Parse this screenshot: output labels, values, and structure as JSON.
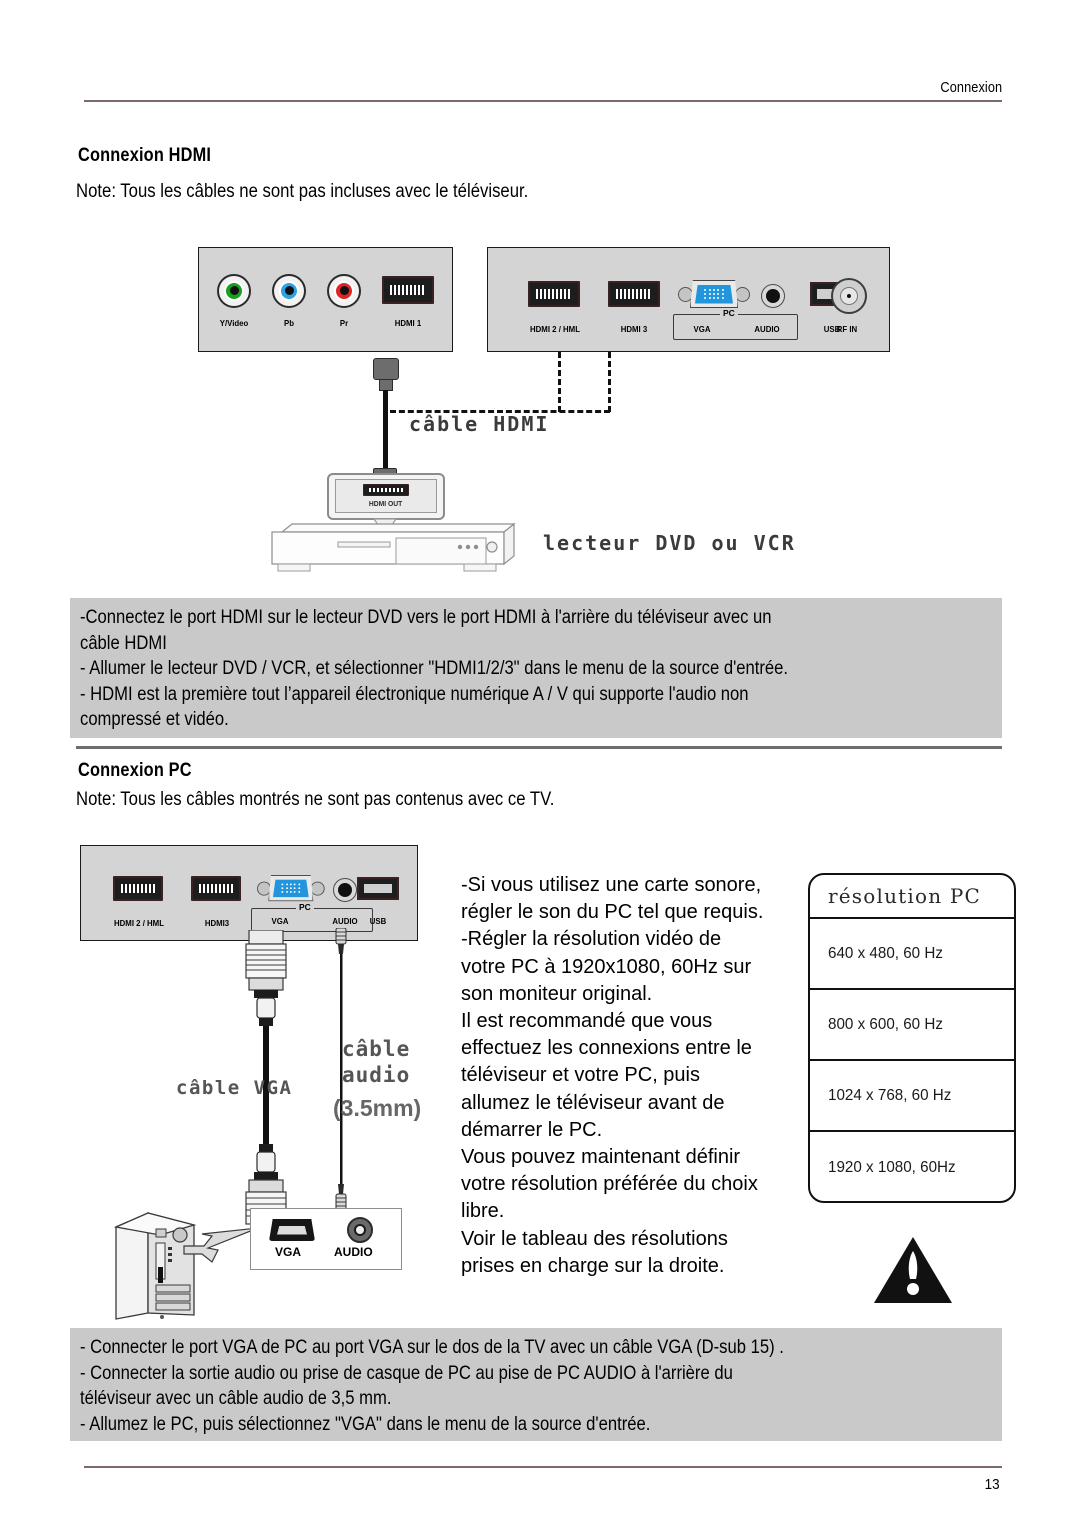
{
  "header": {
    "running_head": "Connexion"
  },
  "footer": {
    "page_number": "13"
  },
  "hdmi_section": {
    "title": "Connexion HDMI",
    "note": "Note: Tous les câbles ne sont pas incluses avec le téléviseur.",
    "left_panel": {
      "ports": [
        {
          "label": "Y/Video",
          "type": "rca-green"
        },
        {
          "label": "Pb",
          "type": "rca-blue"
        },
        {
          "label": "Pr",
          "type": "rca-red"
        },
        {
          "label": "HDMI 1",
          "type": "hdmi"
        }
      ]
    },
    "right_panel": {
      "ports": [
        {
          "label": "HDMI 2 / HML",
          "type": "hdmi"
        },
        {
          "label": "HDMI 3",
          "type": "hdmi"
        },
        {
          "label": "VGA",
          "type": "vga"
        },
        {
          "label": "AUDIO",
          "type": "audio-jack"
        },
        {
          "label": "USB",
          "type": "usb"
        },
        {
          "label": "RF IN",
          "type": "rf"
        }
      ],
      "bracket_label": "PC"
    },
    "diagram_labels": {
      "cable": "câble HDMI",
      "device_port": "HDMI OUT",
      "device": "lecteur DVD ou VCR"
    },
    "instructions": [
      "-Connectez le port HDMI sur le lecteur DVD vers le port HDMI à l'arrière du téléviseur avec un",
      " câble HDMI",
      "- Allumer le lecteur DVD / VCR, et sélectionner \"HDMI1/2/3\" dans le menu de la source d'entrée.",
      "- HDMI est la première tout l’appareil électronique numérique A / V qui supporte l'audio non",
      " compressé et vidéo."
    ]
  },
  "pc_section": {
    "title": "Connexion PC",
    "note": "Note: Tous les câbles montrés ne sont pas contenus avec ce TV.",
    "panel": {
      "ports": [
        {
          "label": "HDMI 2 / HML",
          "type": "hdmi"
        },
        {
          "label": "HDMI3",
          "type": "hdmi"
        },
        {
          "label": "VGA",
          "type": "vga"
        },
        {
          "label": "AUDIO",
          "type": "audio-jack"
        },
        {
          "label": "USB",
          "type": "usb"
        }
      ],
      "bracket_label": "PC"
    },
    "diagram_labels": {
      "vga_cable": "câble VGA",
      "audio_cable_line1": "câble",
      "audio_cable_line2": "audio",
      "audio_cable_line3": "(3.5mm)",
      "pc_vga": "VGA",
      "pc_audio": "AUDIO"
    },
    "body_text": [
      "-Si vous utilisez une carte sonore,",
      " régler le son du PC tel que requis.",
      "-Régler la résolution vidéo de",
      " votre PC à 1920x1080, 60Hz sur",
      " son moniteur original.",
      "Il est recommandé que vous",
      "effectuez les connexions entre le",
      "téléviseur et votre PC, puis",
      "allumez le téléviseur avant de",
      "démarrer le PC.",
      "Vous pouvez maintenant définir",
      "votre résolution préférée du choix",
      "libre.",
      "Voir le tableau des résolutions",
      "prises en charge sur la droite."
    ],
    "resolution_table": {
      "title": "résolution PC",
      "rows": [
        "640 x 480, 60 Hz",
        "800 x 600, 60 Hz",
        "1024 x 768, 60 Hz",
        "1920 x 1080, 60Hz"
      ]
    },
    "instructions": [
      "- Connecter le port VGA de PC au port VGA sur le dos de la TV avec un câble VGA (D-sub 15) .",
      "- Connecter la sortie audio ou prise de casque de PC au pise de PC AUDIO à l'arrière du",
      "  téléviseur avec un câble audio de 3,5 mm.",
      "- Allumez le PC, puis sélectionnez \"VGA\" dans le menu de la source d'entrée."
    ]
  },
  "colors": {
    "gray_box": "#c9c9c9",
    "panel_bg": "#d4d4d4",
    "rule": "#7b6a68",
    "vga_blue": "#2196dd",
    "rca_green": "#15a11d",
    "rca_blue": "#2aa3e0",
    "rca_red": "#e02424"
  }
}
